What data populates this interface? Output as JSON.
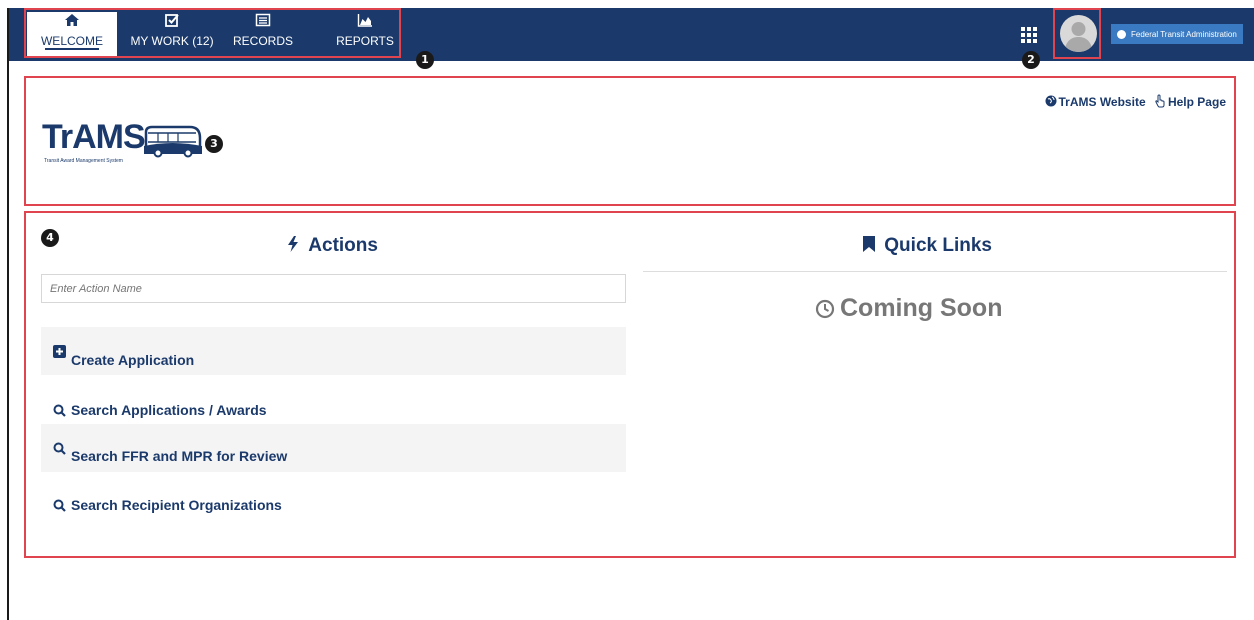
{
  "nav": {
    "items": [
      {
        "label": "WELCOME",
        "icon": "home-icon",
        "active": true
      },
      {
        "label": "MY WORK (12)",
        "icon": "checkbox-icon",
        "active": false
      },
      {
        "label": "RECORDS",
        "icon": "records-icon",
        "active": false
      },
      {
        "label": "REPORTS",
        "icon": "area-chart-icon",
        "active": false
      }
    ],
    "agency_label": "Federal Transit Administration"
  },
  "callouts": [
    "1",
    "2",
    "3",
    "4"
  ],
  "header": {
    "logo_word": "TrAMS",
    "logo_subtitle": "Transit Award Management System",
    "website_link": "TrAMS Website",
    "help_link": "Help Page"
  },
  "actions": {
    "title": "Actions",
    "search_placeholder": "Enter Action Name",
    "items": [
      {
        "label": "Create Application",
        "icon": "plus-square-icon"
      },
      {
        "label": "Search Applications  / Awards",
        "icon": "search-icon"
      },
      {
        "label": "Search FFR and MPR for Review",
        "icon": "search-icon"
      },
      {
        "label": "Search Recipient Organizations",
        "icon": "search-icon"
      }
    ]
  },
  "quick_links": {
    "title": "Quick Links",
    "status": "Coming Soon"
  },
  "colors": {
    "navy": "#1b3a6b",
    "highlight_red": "#e0454f",
    "agency_blue": "#3a7ac2",
    "muted_text": "#777777"
  }
}
